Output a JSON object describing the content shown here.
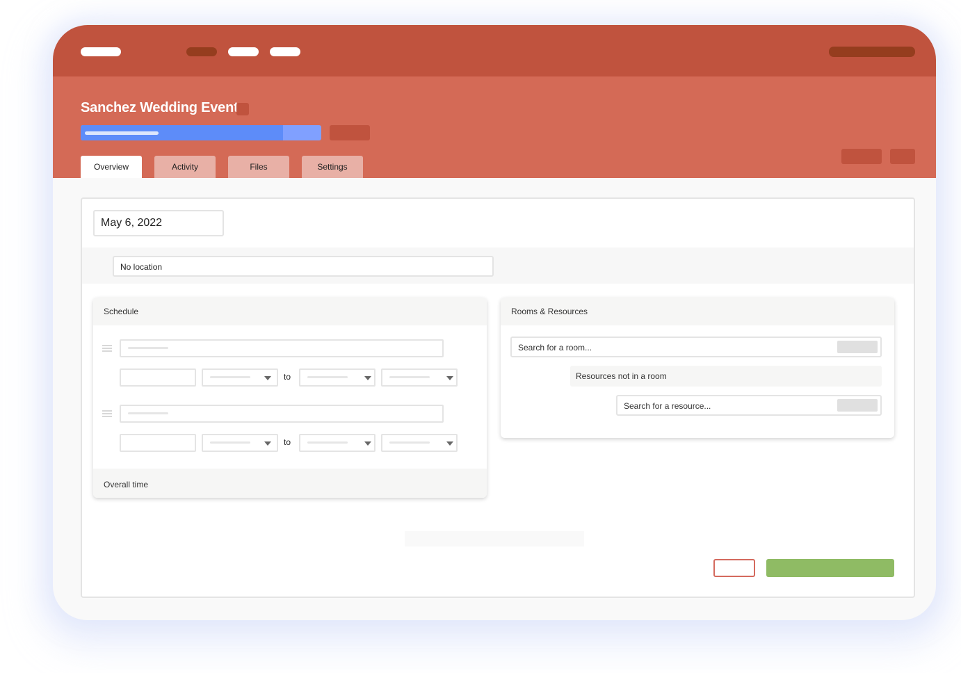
{
  "colors": {
    "topbar": "#c0533e",
    "header": "#d46a56",
    "progress_track": "#80a0ff",
    "progress_fill": "#5d8cf9",
    "save_button": "#8fbb64",
    "cancel_border": "#d46a5e"
  },
  "topbar": {
    "nav_items": [
      {
        "icon": "nav-pill",
        "state": "default"
      },
      {
        "icon": "nav-pill",
        "state": "active"
      },
      {
        "icon": "nav-pill",
        "state": "default"
      },
      {
        "icon": "nav-pill",
        "state": "default"
      }
    ],
    "account_pill": {
      "icon": "account-pill"
    }
  },
  "header": {
    "title": "Sanchez Wedding Event",
    "title_badge_icon": "status-square",
    "progress": {
      "value_percent": 84
    }
  },
  "tabs": [
    {
      "label": "Overview",
      "active": true
    },
    {
      "label": "Activity",
      "active": false
    },
    {
      "label": "Files",
      "active": false
    },
    {
      "label": "Settings",
      "active": false
    }
  ],
  "main": {
    "date": "May 6, 2022",
    "location": "No location",
    "schedule": {
      "title": "Schedule",
      "rows": [
        {
          "separator": "to"
        },
        {
          "separator": "to"
        }
      ],
      "footer": "Overall time"
    },
    "rooms": {
      "title": "Rooms & Resources",
      "room_search_placeholder": "Search for a room...",
      "resources_label": "Resources not in a room",
      "resource_search_placeholder": "Search for a resource..."
    }
  }
}
